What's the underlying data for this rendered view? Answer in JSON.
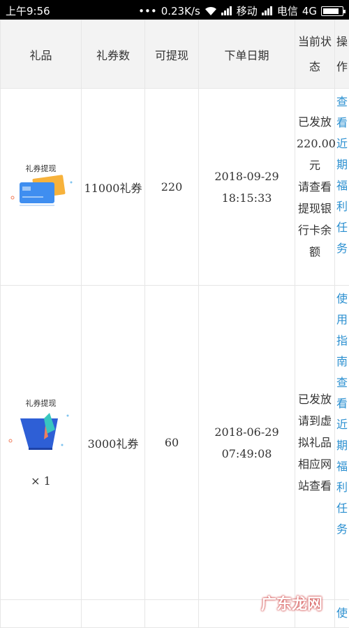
{
  "statusbar": {
    "time": "上午9:56",
    "dots": "•••",
    "speed": "0.23K/s",
    "carrier1": "移动",
    "carrier2": "电信",
    "network": "4G"
  },
  "table": {
    "headers": {
      "gift": "礼品",
      "coupons": "礼券数",
      "withdraw": "可提现",
      "date": "下单日期",
      "status": "当前状\n\n态",
      "action": "操\n\n作"
    },
    "rows": [
      {
        "gift_label": "礼券提现",
        "coupons": "11000礼券",
        "withdraw": "220",
        "date": "2018-09-29\n18:15:33",
        "status": "已发放\n220.00\n元\n请查看\n提现银\n行卡余\n额",
        "action": "查看近期福利任务"
      },
      {
        "gift_label": "礼券提现",
        "qty": "× 1",
        "coupons": "3000礼券",
        "withdraw": "60",
        "date": "2018-06-29\n07:49:08",
        "status": "已发放\n请到虚\n拟礼品\n相应网\n站查看",
        "action1": "使用指南",
        "action2": "查看近期福利任务"
      },
      {
        "action_partial": "使"
      }
    ]
  },
  "watermark": "广东龙网"
}
